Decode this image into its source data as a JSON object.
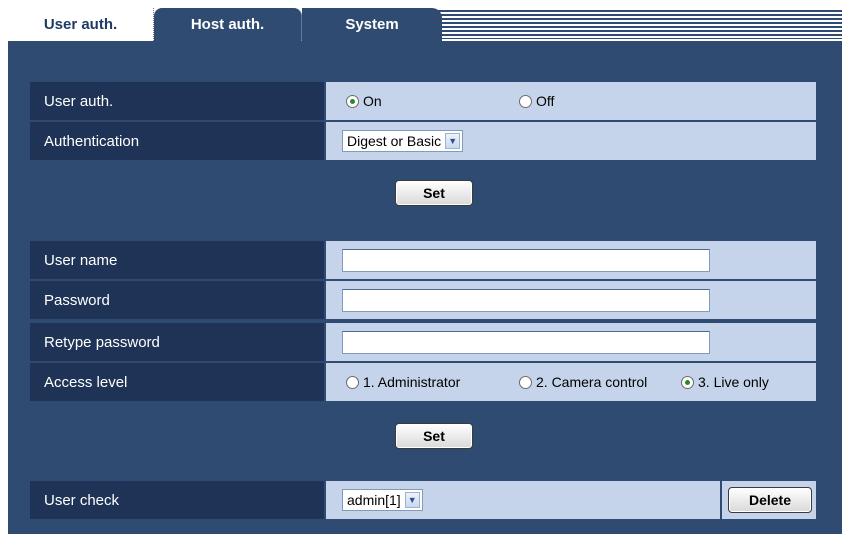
{
  "tabs": [
    {
      "label": "User auth.",
      "active": true
    },
    {
      "label": "Host auth.",
      "active": false
    },
    {
      "label": "System",
      "active": false
    }
  ],
  "user_auth": {
    "label": "User auth.",
    "options": [
      {
        "label": "On",
        "checked": true
      },
      {
        "label": "Off",
        "checked": false
      }
    ]
  },
  "authentication": {
    "label": "Authentication",
    "selected": "Digest or Basic"
  },
  "set_label": "Set",
  "user_name": {
    "label": "User name",
    "value": ""
  },
  "password": {
    "label": "Password",
    "value": ""
  },
  "retype_password": {
    "label": "Retype password",
    "value": ""
  },
  "access_level": {
    "label": "Access level",
    "options": [
      {
        "label": "1. Administrator",
        "checked": false
      },
      {
        "label": "2. Camera control",
        "checked": false
      },
      {
        "label": "3. Live only",
        "checked": true
      }
    ]
  },
  "user_check": {
    "label": "User check",
    "selected": "admin[1]",
    "delete_label": "Delete"
  },
  "colors": {
    "panel": "#2f4b71",
    "label_bg": "#1e3355",
    "field_bg": "#c5d4ea",
    "radio_checked": "#2a8a2a"
  }
}
